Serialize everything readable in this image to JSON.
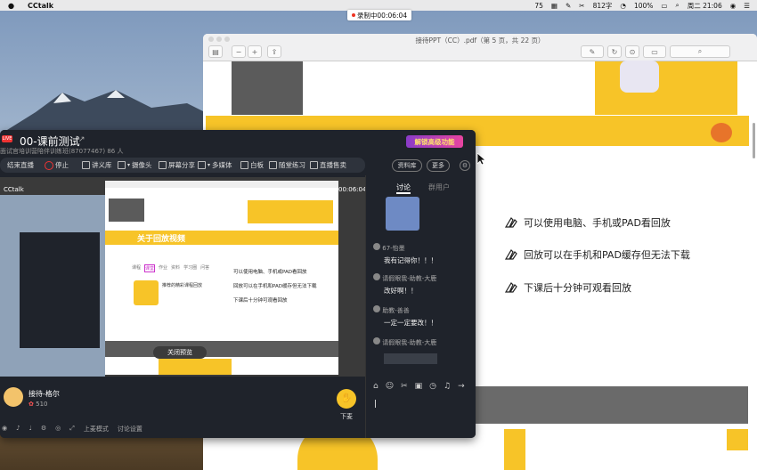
{
  "menubar": {
    "app_name": "CCtalk",
    "battery_level": "75",
    "words": "812字",
    "battery": "100%",
    "clock": "周二 21:06"
  },
  "recording": {
    "label": "录制中00:06:04"
  },
  "pdf": {
    "title": "接待PPT（CC）.pdf（第 5 页，共 22 页）",
    "items": [
      "可以使用电脑、手机或PAD看回放",
      "回放可以在手机和PAD缓存但无法下载",
      "下课后十分钟可观看回放"
    ]
  },
  "cctalk": {
    "live_badge": "LIVE",
    "title": "00-课前测试",
    "subtitle": "面试官培训营陪伴训练班(87077467)  86 人",
    "feature_badge": "解锁高级功能",
    "toolbar": {
      "end_live": "结束直播",
      "stop": "停止",
      "courseware": "讲义库",
      "camera": "摄像头",
      "screen_share": "屏幕分享",
      "media": "多媒体",
      "whiteboard": "白板",
      "practice": "随堂练习",
      "sell": "直播售卖",
      "material": "资料库",
      "more": "更多"
    },
    "stage_label": "CCtalk",
    "stage_time": "00:06:04",
    "inner": {
      "banner": "关于回放视频",
      "close_preview": "关闭预览",
      "items": [
        "可以使用电脑、手机或PAD看回放",
        "回放可以在手机和PAD缓存但无法下载",
        "下课后十分钟可观看回放"
      ],
      "tabs": [
        "课程",
        "课堂",
        "作业",
        "资料",
        "学习圈",
        "问答"
      ],
      "card_label": "推荐的精彩课程回放"
    },
    "chat": {
      "tab_discuss": "讨论",
      "tab_members": "群用户",
      "messages": [
        {
          "user": "67-怡墨",
          "text": "我有记得你！！！"
        },
        {
          "user": "请假眼我-助教-大鹿",
          "text": "改好啊！！"
        },
        {
          "user": "助教-善善",
          "text": "一定一定要改！！"
        },
        {
          "user": "请假眼我-助教-大鹿",
          "text": ""
        }
      ]
    },
    "host": {
      "name": "接待-格尔",
      "points": "510"
    },
    "raise_hand": "下麦",
    "bottom_tools": {
      "mode": "上麦模式",
      "discuss_settings": "讨论设置"
    }
  }
}
